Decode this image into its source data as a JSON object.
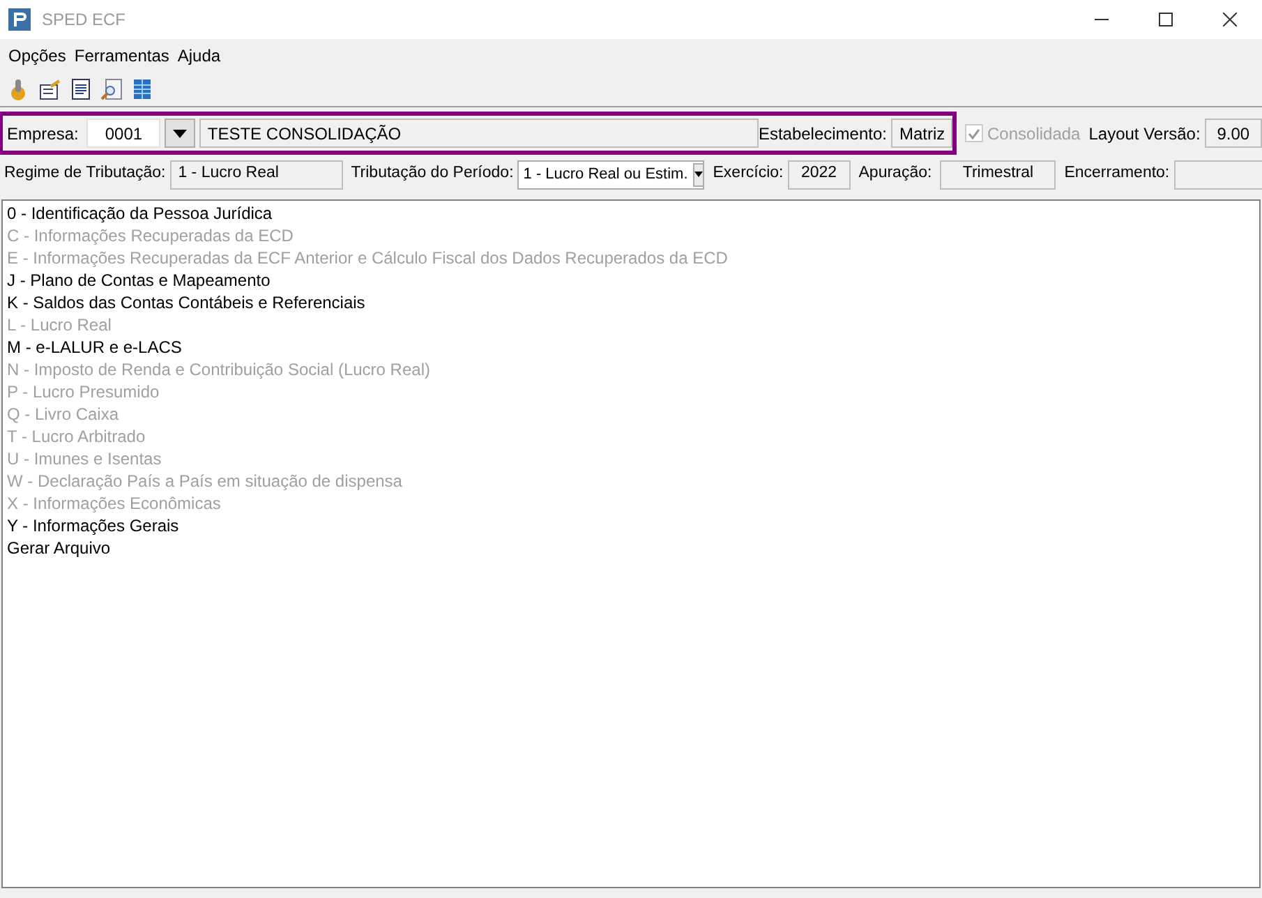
{
  "window": {
    "title": "SPED ECF"
  },
  "menu": [
    "Opções",
    "Ferramentas",
    "Ajuda"
  ],
  "header": {
    "empresa_label": "Empresa:",
    "empresa_code": "0001",
    "empresa_name": "TESTE CONSOLIDAÇÃO",
    "estabelecimento_label": "Estabelecimento:",
    "estabelecimento": "Matriz",
    "consolidada": {
      "label": "Consolidada",
      "checked": true,
      "disabled": true
    },
    "layout_label": "Layout Versão:",
    "layout": "9.00",
    "regime_label": "Regime de Tributação:",
    "regime": "1 - Lucro Real",
    "periodo_label": "Tributação do Período:",
    "periodo": "1 - Lucro Real ou Estim.",
    "exercicio_label": "Exercício:",
    "exercicio": "2022",
    "apuracao_label": "Apuração:",
    "apuracao": "Trimestral",
    "encerramento_label": "Encerramento:"
  },
  "items": [
    {
      "label": "0 - Identificação da Pessoa Jurídica",
      "disabled": false
    },
    {
      "label": "C - Informações Recuperadas da ECD",
      "disabled": true
    },
    {
      "label": "E - Informações Recuperadas da ECF Anterior e Cálculo Fiscal dos Dados Recuperados da ECD",
      "disabled": true
    },
    {
      "label": "J - Plano de Contas e Mapeamento",
      "disabled": false
    },
    {
      "label": "K - Saldos das Contas Contábeis e Referenciais",
      "disabled": false
    },
    {
      "label": "L - Lucro Real",
      "disabled": true
    },
    {
      "label": "M - e-LALUR e e-LACS",
      "disabled": false
    },
    {
      "label": "N - Imposto de Renda e Contribuição Social (Lucro Real)",
      "disabled": true
    },
    {
      "label": "P - Lucro Presumido",
      "disabled": true
    },
    {
      "label": "Q - Livro Caixa",
      "disabled": true
    },
    {
      "label": "T - Lucro Arbitrado",
      "disabled": true
    },
    {
      "label": "U - Imunes e Isentas",
      "disabled": true
    },
    {
      "label": "W - Declaração País a País em situação de dispensa",
      "disabled": true
    },
    {
      "label": "X - Informações Econômicas",
      "disabled": true
    },
    {
      "label": "Y - Informações Gerais",
      "disabled": false
    },
    {
      "label": "Gerar Arquivo",
      "disabled": false
    }
  ]
}
